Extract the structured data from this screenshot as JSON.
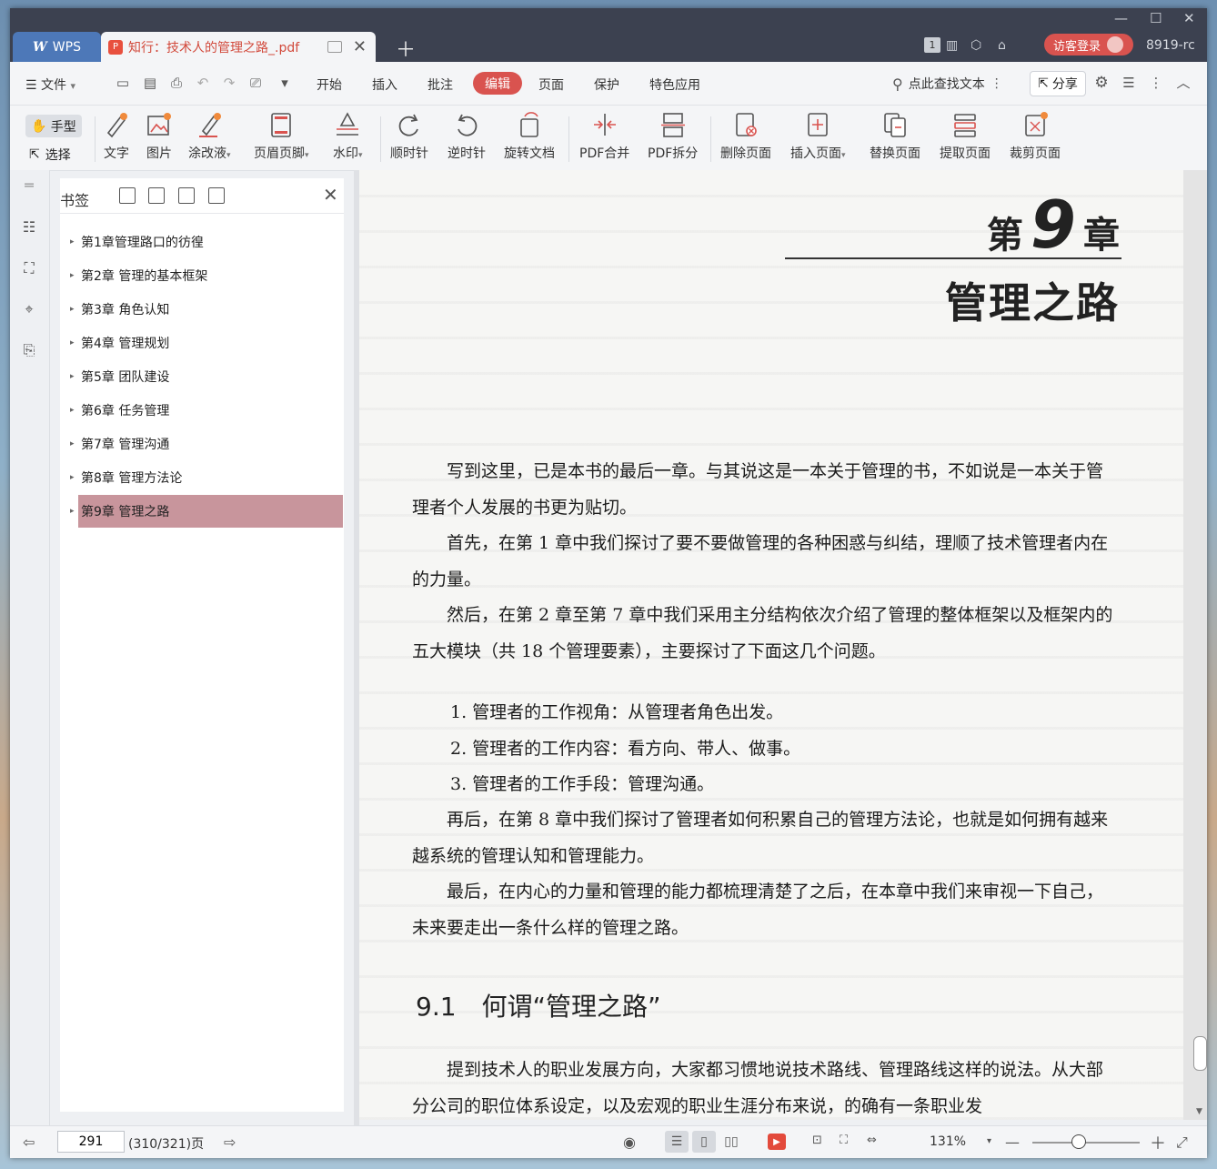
{
  "titlebar": {
    "app_tab": "WPS",
    "app_logo": "W",
    "doc_tab": "知行：技术人的管理之路_.pdf",
    "page_count_badge": "1",
    "guest_login": "访客登录",
    "user_id": "8919-rc"
  },
  "menu": {
    "file": "文件",
    "items": [
      "开始",
      "插入",
      "批注",
      "编辑",
      "页面",
      "保护",
      "特色应用"
    ],
    "active": "编辑",
    "search": "点此查找文本",
    "share": "分享"
  },
  "ribbon": {
    "hand": "手型",
    "select": "选择",
    "buttons": [
      "文字",
      "图片",
      "涂改液",
      "页眉页脚",
      "水印",
      "顺时针",
      "逆时针",
      "旋转文档",
      "PDF合并",
      "PDF拆分",
      "删除页面",
      "插入页面",
      "替换页面",
      "提取页面",
      "裁剪页面"
    ]
  },
  "bookmarks": {
    "title": "书签",
    "items": [
      "第1章管理路口的彷徨",
      "第2章 管理的基本框架",
      "第3章 角色认知",
      "第4章 管理规划",
      "第5章 团队建设",
      "第6章 任务管理",
      "第7章 管理沟通",
      "第8章 管理方法论",
      "第9章 管理之路"
    ],
    "selected_index": 8
  },
  "document": {
    "chapter_word1": "第",
    "chapter_num": "9",
    "chapter_word2": "章",
    "chapter_title": "管理之路",
    "p1": "写到这里，已是本书的最后一章。与其说这是一本关于管理的书，不如说是一本关于管理者个人发展的书更为贴切。",
    "p2": "首先，在第 1 章中我们探讨了要不要做管理的各种困惑与纠结，理顺了技术管理者内在的力量。",
    "p3": "然后，在第 2 章至第 7 章中我们采用主分结构依次介绍了管理的整体框架以及框架内的五大模块（共 18 个管理要素），主要探讨了下面这几个问题。",
    "list": [
      "1.  管理者的工作视角：从管理者角色出发。",
      "2.  管理者的工作内容：看方向、带人、做事。",
      "3.  管理者的工作手段：管理沟通。"
    ],
    "p4": "再后，在第 8 章中我们探讨了管理者如何积累自己的管理方法论，也就是如何拥有越来越系统的管理认知和管理能力。",
    "p5": "最后，在内心的力量和管理的能力都梳理清楚了之后，在本章中我们来审视一下自己，未来要走出一条什么样的管理之路。",
    "section": "9.1　何谓“管理之路”",
    "p6": "提到技术人的职业发展方向，大家都习惯地说技术路线、管理路线这样的说法。从大部分公司的职位体系设定，以及宏观的职业生涯分布来说，的确有一条职业发"
  },
  "status": {
    "current_page": "291",
    "page_info": "(310/321)页",
    "zoom": "131%",
    "zoom_fraction": 0.42
  }
}
